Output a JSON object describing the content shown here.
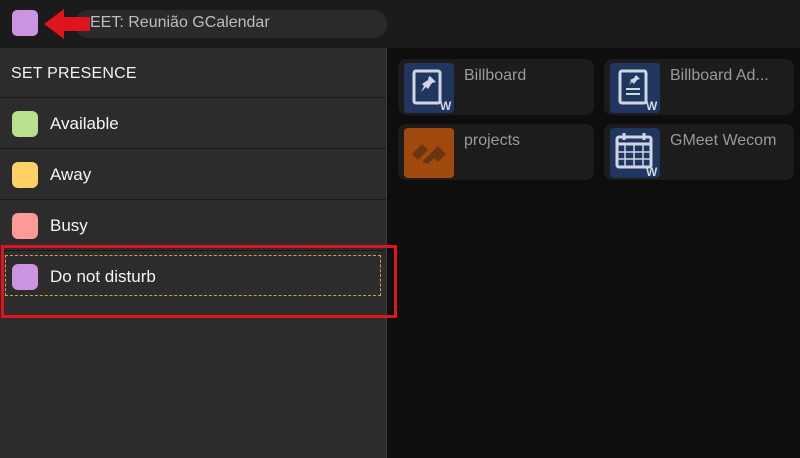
{
  "topbar": {
    "meeting_title": "EET: Reunião GCalendar",
    "presence_color": "#cc93e0"
  },
  "tiles": [
    {
      "label": "Billboard",
      "icon": "billboard-icon",
      "color": "#2b4a84"
    },
    {
      "label": "Billboard Ad...",
      "icon": "billboard-admin-icon",
      "color": "#2b4a84"
    },
    {
      "label": "projects",
      "icon": "projects-icon",
      "color": "#b95a12"
    },
    {
      "label": "GMeet Wecom",
      "icon": "calendar-icon",
      "color": "#2b4a84"
    }
  ],
  "panel": {
    "title": "SET PRESENCE",
    "items": [
      {
        "label": "Available",
        "color": "#b9e08e"
      },
      {
        "label": "Away",
        "color": "#ffd166"
      },
      {
        "label": "Busy",
        "color": "#ff9a96"
      },
      {
        "label": "Do not disturb",
        "color": "#cc93e0"
      }
    ]
  },
  "annotation_color": "#e0141f"
}
